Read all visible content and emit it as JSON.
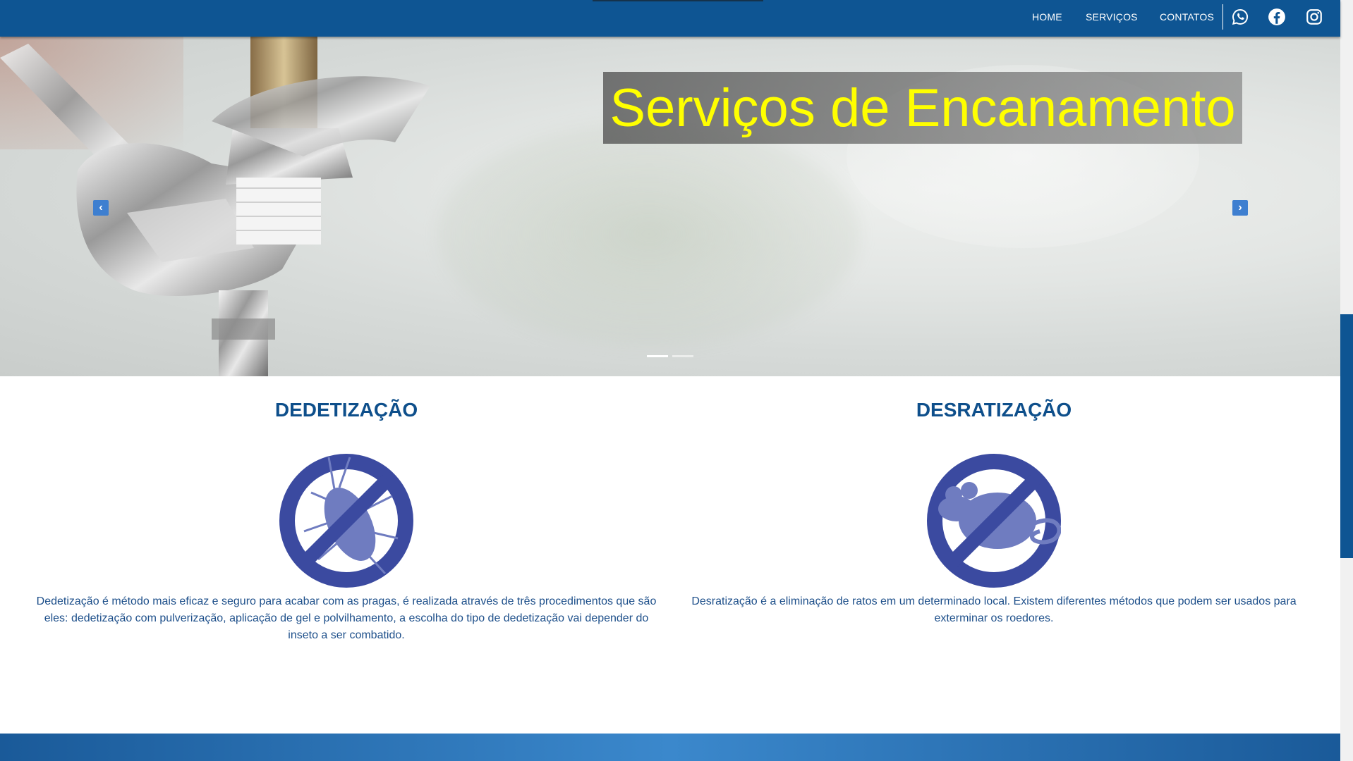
{
  "nav": {
    "links": [
      "HOME",
      "SERVIÇOS",
      "CONTATOS"
    ],
    "icons": [
      "whatsapp-icon",
      "facebook-icon",
      "instagram-icon"
    ],
    "color": "#0e5593"
  },
  "hero": {
    "title": "Serviços de Encanamento",
    "title_color": "#ffff00",
    "prev_arrow": "‹",
    "next_arrow": "›",
    "slide_count": 2,
    "active_slide": 1
  },
  "services": [
    {
      "title": "DEDETIZAÇÃO",
      "icon": "no-cockroach-icon",
      "text": "Dedetização é método mais eficaz e seguro para acabar com as pragas, é realizada através de três procedimentos que são eles: dedetização com pulverização, aplicação de gel e polvilhamento, a escolha do tipo de dedetização vai depender do inseto a ser combatido."
    },
    {
      "title": "DESRATIZAÇÃO",
      "icon": "no-rat-icon",
      "text": "Desratização é a eliminação de ratos em um determinado local. Existem diferentes métodos que podem ser usados para exterminar os roedores."
    }
  ],
  "colors": {
    "brand_blue": "#0e5593",
    "heading_blue": "#0e4f8b",
    "icon_blue": "#3b4aa0",
    "icon_fill": "#6f7cc0"
  }
}
